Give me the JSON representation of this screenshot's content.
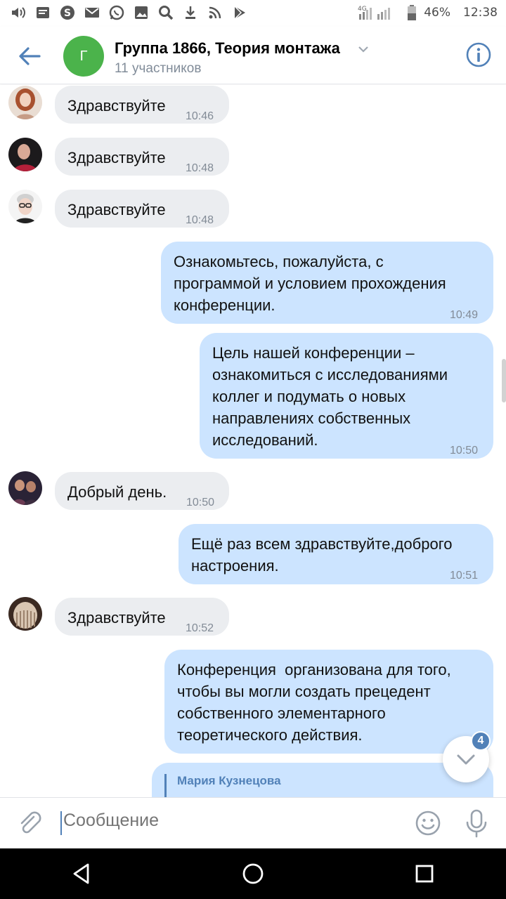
{
  "status_bar": {
    "network": "4G",
    "battery": "46%",
    "time": "12:38"
  },
  "header": {
    "avatar_letter": "Г",
    "title": "Группа 1866, Теория монтажа",
    "subtitle": "11 участников",
    "avatar_color": "#4bb34b",
    "accent": "#5181b8"
  },
  "messages": [
    {
      "dir": "in",
      "text": "Здравствуйте",
      "time": "10:46"
    },
    {
      "dir": "in",
      "text": "Здравствуйте",
      "time": "10:48"
    },
    {
      "dir": "in",
      "text": "Здравствуйте",
      "time": "10:48"
    },
    {
      "dir": "out",
      "lines": [
        "Ознакомьтесь, пожалуйста, с",
        "программой и условием прохождения",
        "конференции."
      ],
      "time": "10:49"
    },
    {
      "dir": "out",
      "lines": [
        "Цель нашей конференции –",
        "ознакомиться с исследованиями",
        "коллег и подумать о новых",
        "направлениях собственных",
        "исследований."
      ],
      "time": "10:50"
    },
    {
      "dir": "in",
      "text": "Добрый день.",
      "time": "10:50"
    },
    {
      "dir": "out",
      "lines": [
        "Ещё раз всем здравствуйте,доброго",
        "настроения."
      ],
      "time": "10:51"
    },
    {
      "dir": "in",
      "text": "Здравствуйте",
      "time": "10:52"
    },
    {
      "dir": "out",
      "lines": [
        "Конференция  организована для того,",
        "чтобы вы могли создать прецедент",
        "собственного элементарного",
        "теоретического действия."
      ],
      "time": ""
    }
  ],
  "reply": {
    "name": "Мария Кузнецова"
  },
  "scroll_down": {
    "badge": "4"
  },
  "composer": {
    "placeholder": "Сообщение"
  },
  "icons": {
    "back": "arrow-left-icon",
    "info": "info-icon",
    "attach": "paperclip-icon",
    "emoji": "smile-icon",
    "mic": "microphone-icon"
  }
}
